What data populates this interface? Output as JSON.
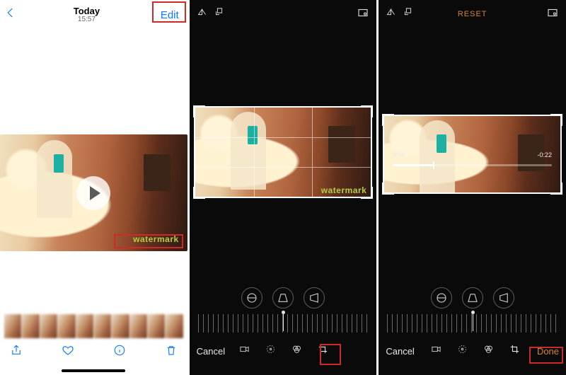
{
  "pane1": {
    "title": "Today",
    "time": "15:57",
    "edit_label": "Edit",
    "watermark_text": "watermark"
  },
  "pane2": {
    "cancel_label": "Cancel",
    "watermark_text": "watermark"
  },
  "pane3": {
    "reset_label": "RESET",
    "cancel_label": "Cancel",
    "done_label": "Done",
    "trim_start": "0:06",
    "trim_end": "-0:22"
  }
}
